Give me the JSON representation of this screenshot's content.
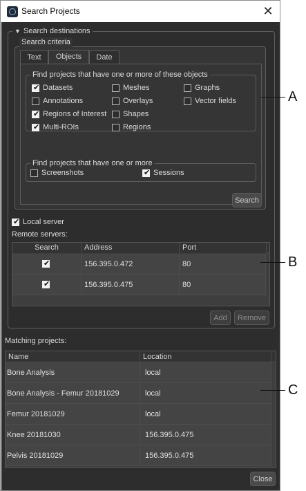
{
  "window": {
    "title": "Search Projects"
  },
  "search_destinations": {
    "label": "Search destinations",
    "criteria": {
      "label": "Search criteria",
      "tabs": [
        {
          "label": "Text"
        },
        {
          "label": "Objects"
        },
        {
          "label": "Date"
        }
      ],
      "active_tab": "Objects",
      "objects_group": {
        "label": "Find projects that have one or more of these objects",
        "items": [
          {
            "label": "Datasets",
            "checked": true
          },
          {
            "label": "Meshes",
            "checked": false
          },
          {
            "label": "Graphs",
            "checked": false
          },
          {
            "label": "Annotations",
            "checked": false
          },
          {
            "label": "Overlays",
            "checked": false
          },
          {
            "label": "Vector fields",
            "checked": false
          },
          {
            "label": "Regions of Interest",
            "checked": true
          },
          {
            "label": "Shapes",
            "checked": false
          },
          {
            "label": "Multi-ROIs",
            "checked": true
          },
          {
            "label": "Regions",
            "checked": false
          }
        ]
      },
      "other_group": {
        "label": "Find projects that have one or more",
        "items": [
          {
            "label": "Screenshots",
            "checked": false
          },
          {
            "label": "Sessions",
            "checked": true
          }
        ]
      },
      "search_button": "Search"
    },
    "local_server": {
      "label": "Local server",
      "checked": true
    },
    "remote_servers": {
      "label": "Remote servers:",
      "columns": [
        "Search",
        "Address",
        "Port"
      ],
      "rows": [
        {
          "search": true,
          "address": "156.395.0.472",
          "port": "80"
        },
        {
          "search": true,
          "address": "156.395.0.475",
          "port": "80"
        }
      ],
      "add_button": "Add",
      "remove_button": "Remove"
    }
  },
  "matching": {
    "label": "Matching projects:",
    "columns": [
      "Name",
      "Location"
    ],
    "rows": [
      {
        "name": "Bone Analysis",
        "location": "local"
      },
      {
        "name": "Bone Analysis - Femur 20181029",
        "location": "local"
      },
      {
        "name": "Femur 20181029",
        "location": "local"
      },
      {
        "name": "Knee 20181030",
        "location": "156.395.0.475"
      },
      {
        "name": "Pelvis 20181029",
        "location": "156.395.0.475"
      }
    ]
  },
  "close_button": "Close",
  "callouts": [
    "A",
    "B",
    "C"
  ]
}
